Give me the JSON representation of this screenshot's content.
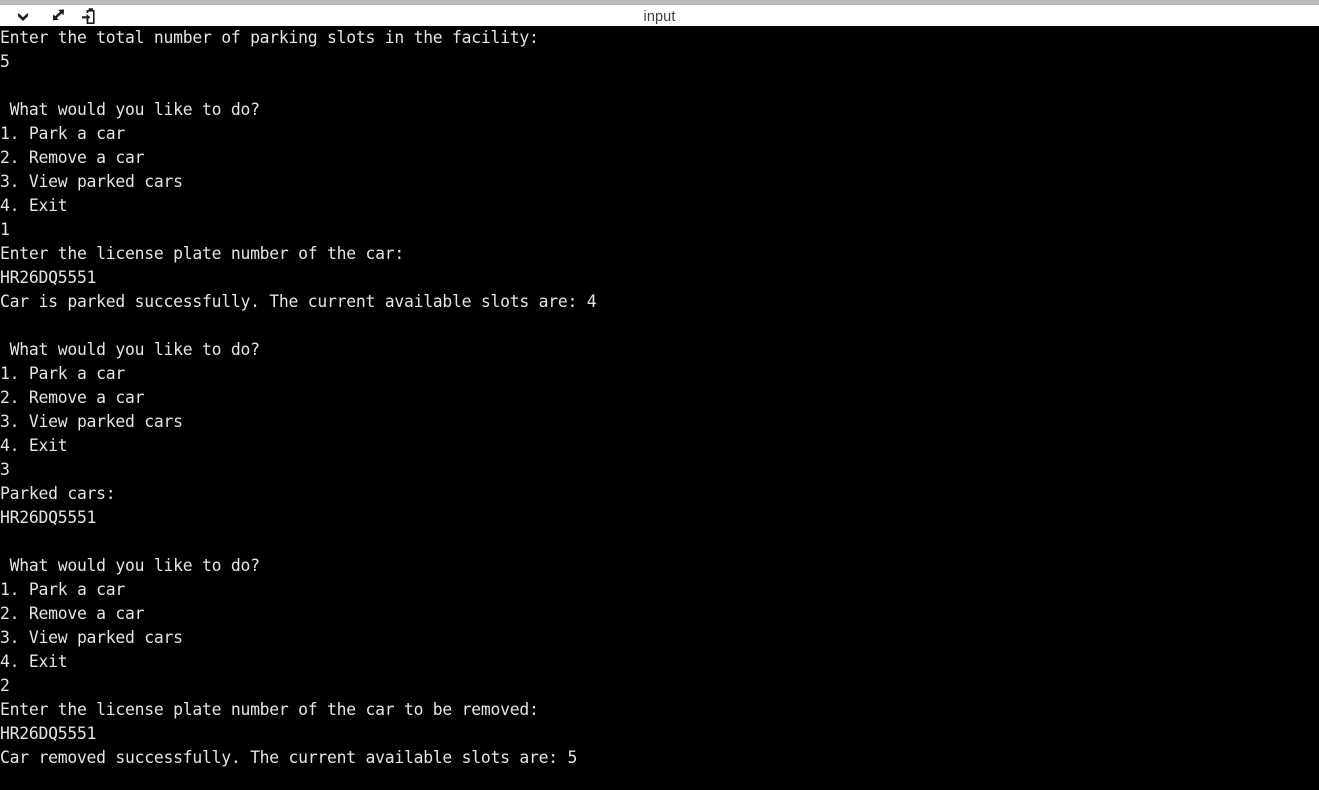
{
  "window": {
    "title": "input",
    "title_color": "#3f3f3f",
    "toolbar_bg": "#ffffff",
    "strip_color": "#bcbcbc"
  },
  "toolbar": {
    "buttons": [
      {
        "name": "chevron-down-icon",
        "label": "Show output dropdown"
      },
      {
        "name": "expand-arrows-icon",
        "label": "Maximize panel"
      },
      {
        "name": "clipboard-paste-icon",
        "label": "Copy to clipboard"
      }
    ]
  },
  "terminal": {
    "background": "#000000",
    "foreground": "#e4e4e4",
    "lines": [
      "Enter the total number of parking slots in the facility:",
      "5",
      "",
      " What would you like to do?",
      "1. Park a car",
      "2. Remove a car",
      "3. View parked cars",
      "4. Exit",
      "1",
      "Enter the license plate number of the car:",
      "HR26DQ5551",
      "Car is parked successfully. The current available slots are: 4",
      "",
      " What would you like to do?",
      "1. Park a car",
      "2. Remove a car",
      "3. View parked cars",
      "4. Exit",
      "3",
      "Parked cars:",
      "HR26DQ5551",
      "",
      " What would you like to do?",
      "1. Park a car",
      "2. Remove a car",
      "3. View parked cars",
      "4. Exit",
      "2",
      "Enter the license plate number of the car to be removed:",
      "HR26DQ5551",
      "Car removed successfully. The current available slots are: 5"
    ]
  }
}
